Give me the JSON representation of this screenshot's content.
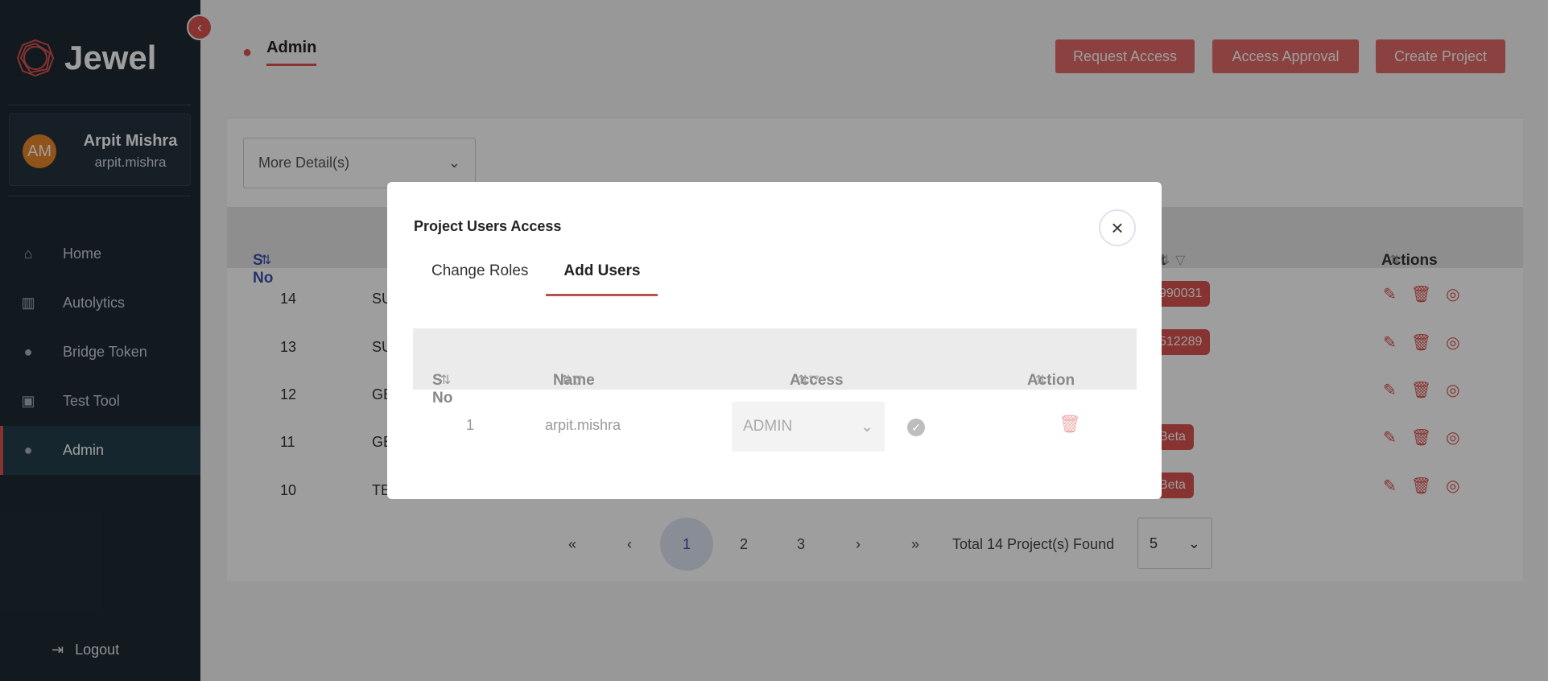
{
  "app": {
    "name": "Jewel"
  },
  "user": {
    "initials": "AM",
    "name": "Arpit Mishra",
    "username": "arpit.mishra"
  },
  "sidebar": {
    "items": [
      {
        "label": "Home",
        "icon": "home-icon"
      },
      {
        "label": "Autolytics",
        "icon": "bar-chart-icon"
      },
      {
        "label": "Bridge Token",
        "icon": "user-lock-icon"
      },
      {
        "label": "Test Tool",
        "icon": "toolbox-icon"
      },
      {
        "label": "Admin",
        "icon": "user-icon",
        "active": true
      }
    ],
    "logout": "Logout"
  },
  "header": {
    "tab": "Admin",
    "buttons": {
      "request_access": "Request Access",
      "access_approval": "Access Approval",
      "create_project": "Create Project"
    }
  },
  "filter": {
    "more_details": "More Detail(s)"
  },
  "table": {
    "headers": {
      "sno": "S No",
      "partial": "nt",
      "actions": "Actions"
    },
    "rows": [
      {
        "sno": "14",
        "name": "SU",
        "badge": "990031"
      },
      {
        "sno": "13",
        "name": "SU",
        "badge": "512289"
      },
      {
        "sno": "12",
        "name": "GE",
        "badge": ""
      },
      {
        "sno": "11",
        "name": "GE",
        "badge": "Beta"
      },
      {
        "sno": "10",
        "name": "TE",
        "badge": "Beta"
      }
    ]
  },
  "pagination": {
    "first": "«",
    "prev": "‹",
    "pages": [
      "1",
      "2",
      "3"
    ],
    "next": "›",
    "last": "»",
    "summary": "Total 14 Project(s) Found",
    "page_size": "5"
  },
  "modal": {
    "title": "Project Users Access",
    "tabs": [
      "Change Roles",
      "Add Users"
    ],
    "active_tab": "Add Users",
    "headers": {
      "sno": "S No",
      "name": "Name",
      "access": "Access",
      "action": "Action"
    },
    "rows": [
      {
        "sno": "1",
        "name": "arpit.mishra",
        "access": "ADMIN"
      }
    ]
  },
  "colors": {
    "accent": "#d9534f",
    "sidebar": "#1e2a33"
  }
}
